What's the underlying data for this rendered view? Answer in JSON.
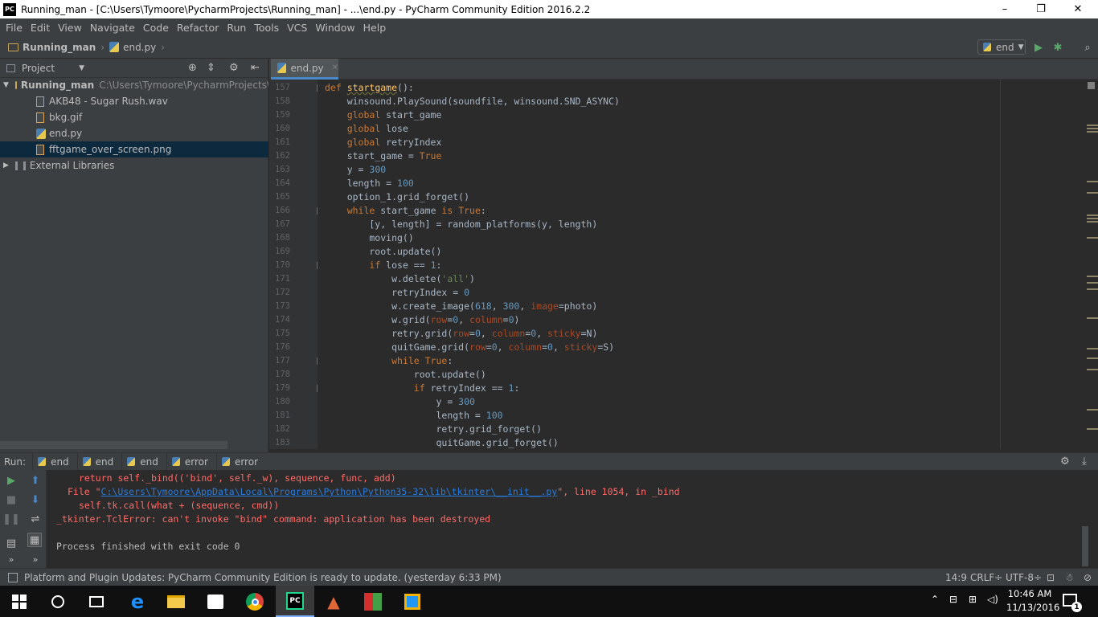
{
  "window": {
    "title": "Running_man - [C:\\Users\\Tymoore\\PycharmProjects\\Running_man] - ...\\end.py - PyCharm Community Edition 2016.2.2",
    "app_icon": "PC",
    "controls": [
      "–",
      "❐",
      "✕"
    ]
  },
  "menu": [
    "File",
    "Edit",
    "View",
    "Navigate",
    "Code",
    "Refactor",
    "Run",
    "Tools",
    "VCS",
    "Window",
    "Help"
  ],
  "breadcrumb": {
    "project": "Running_man",
    "file": "end.py"
  },
  "run_config": "end",
  "project_panel": {
    "label": "Project",
    "root": {
      "name": "Running_man",
      "path": "C:\\Users\\Tymoore\\PycharmProjects\\Ru"
    },
    "files": [
      "AKB48 - Sugar Rush.wav",
      "bkg.gif",
      "end.py",
      "fftgame_over_screen.png"
    ],
    "external": "External Libraries"
  },
  "editor_tab": "end.py",
  "line_numbers": [
    "157",
    "158",
    "159",
    "160",
    "161",
    "162",
    "163",
    "164",
    "165",
    "166",
    "167",
    "168",
    "169",
    "170",
    "171",
    "172",
    "173",
    "174",
    "175",
    "176",
    "177",
    "178",
    "179",
    "180",
    "181",
    "182",
    "183"
  ],
  "run_panel": {
    "label": "Run:",
    "tabs": [
      "end",
      "end",
      "end",
      "error",
      "error"
    ]
  },
  "console": {
    "line1": "return self._bind(('bind', self._w), sequence, func, add)",
    "file_prefix": "File \"",
    "file_link": "C:\\Users\\Tymoore\\AppData\\Local\\Programs\\Python\\Python35-32\\lib\\tkinter\\__init__.py",
    "file_suffix": "\", line 1054, in _bind",
    "line3": "self.tk.call(what + (sequence, cmd))",
    "line4": "_tkinter.TclError: can't invoke \"bind\" command: application has been destroyed",
    "finished": "Process finished with exit code 0"
  },
  "status": {
    "message": "Platform and Plugin Updates: PyCharm Community Edition is ready to update. (yesterday 6:33 PM)",
    "position": "14:9",
    "line_sep": "CRLF÷",
    "encoding": "UTF-8÷"
  },
  "taskbar": {
    "time": "10:46 AM",
    "date": "11/13/2016",
    "notifications": "1"
  },
  "colors": {
    "keyword": "#cc7832",
    "number": "#6897bb",
    "string": "#6a8759",
    "param": "#aa4926",
    "error": "#ff6b68",
    "link": "#287bde"
  }
}
